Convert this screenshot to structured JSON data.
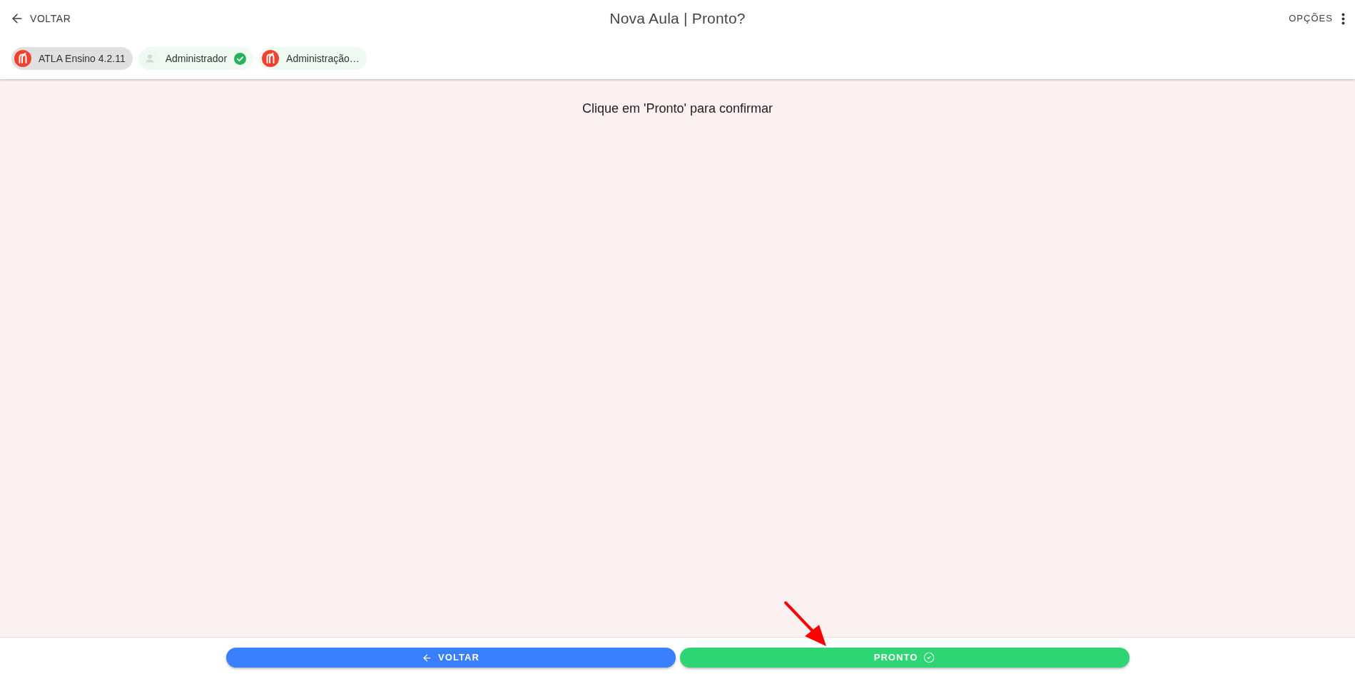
{
  "header": {
    "back": {
      "label": "VOLTAR"
    },
    "title": "Nova Aula | Pronto?",
    "options": {
      "label": "OPÇÕES"
    }
  },
  "chips": [
    {
      "kind": "logo",
      "label": "ATLA Ensino 4.2.11",
      "selected": true,
      "verified": false
    },
    {
      "kind": "user",
      "label": "Administrador",
      "selected": false,
      "verified": true
    },
    {
      "kind": "logo",
      "label": "Administração…",
      "selected": false,
      "verified": false
    }
  ],
  "message": "Clique em 'Pronto' para confirmar",
  "footer": {
    "buttons": [
      {
        "kind": "back",
        "label": "VOLTAR"
      },
      {
        "kind": "confirm",
        "label": "PRONTO"
      }
    ]
  }
}
